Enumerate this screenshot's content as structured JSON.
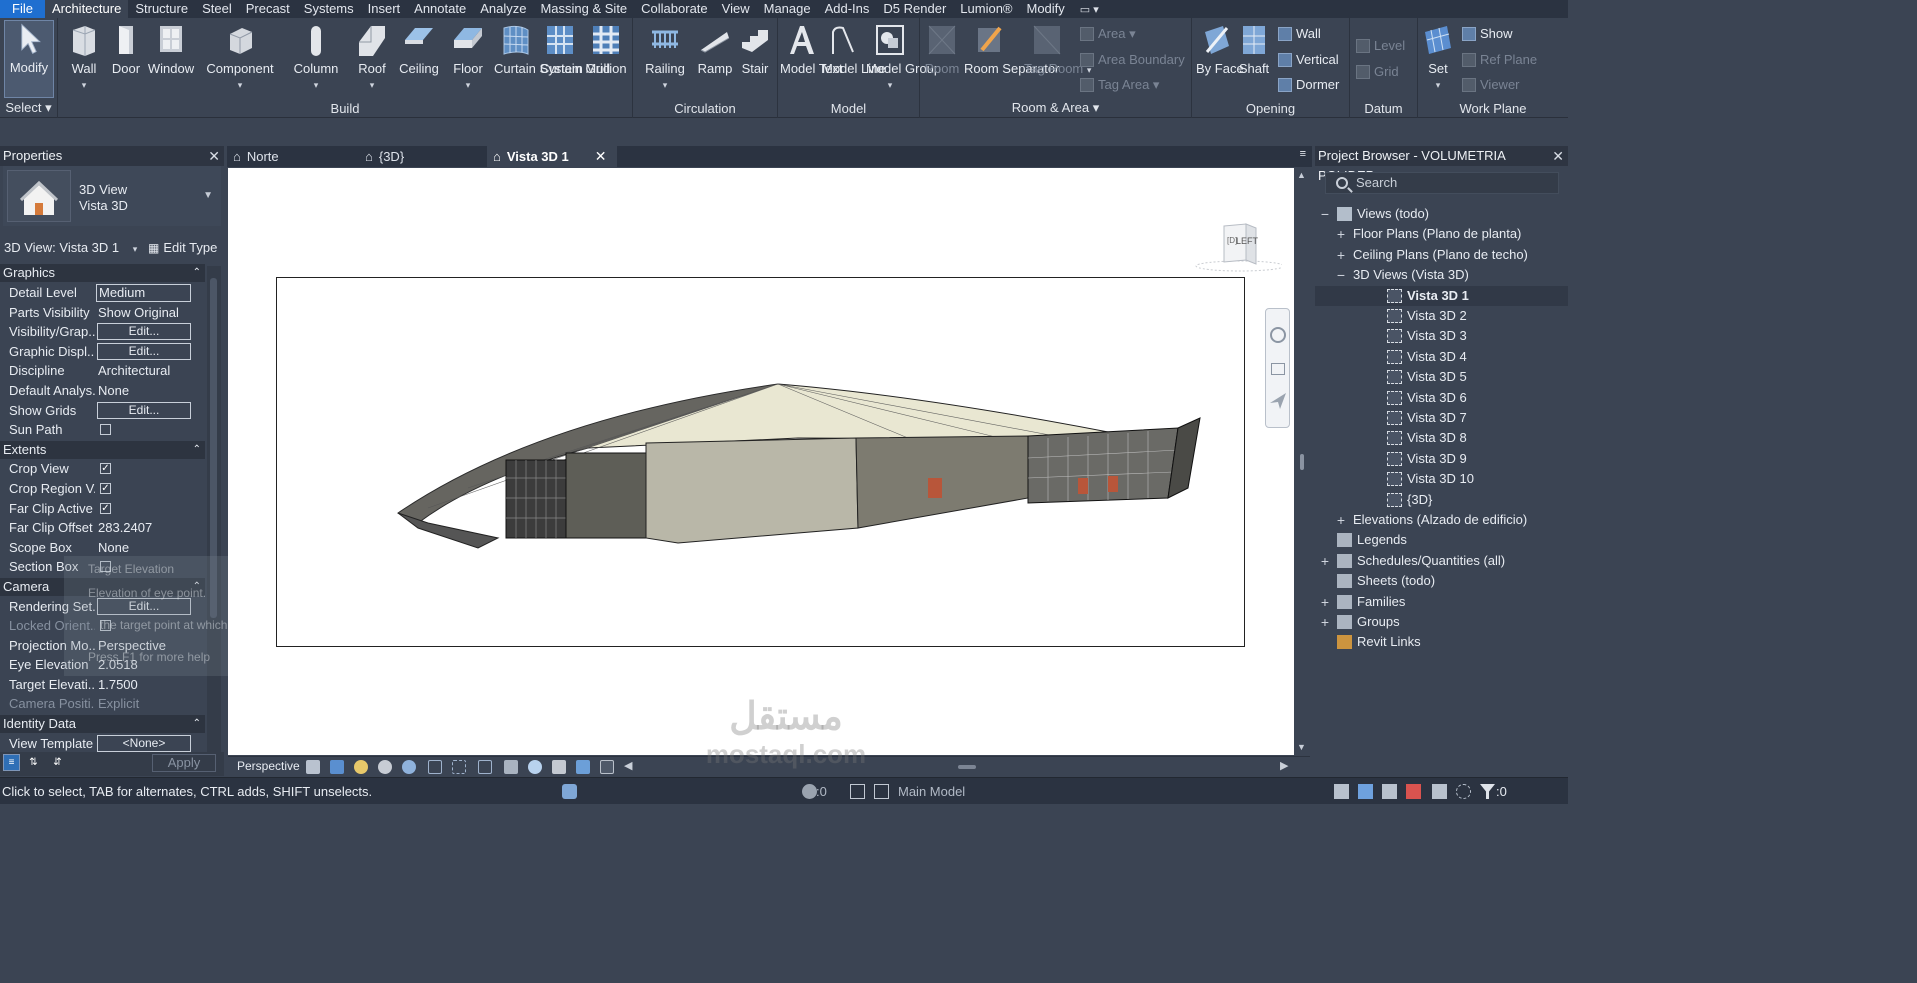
{
  "menu": {
    "items": [
      "File",
      "Architecture",
      "Structure",
      "Steel",
      "Precast",
      "Systems",
      "Insert",
      "Annotate",
      "Analyze",
      "Massing & Site",
      "Collaborate",
      "View",
      "Manage",
      "Add-Ins",
      "D5 Render",
      "Lumion®",
      "Modify"
    ],
    "active": "Architecture",
    "extra": "▭ ▾"
  },
  "ribbon": {
    "select": {
      "tool": "Modify",
      "title": "Select ▾"
    },
    "build": {
      "title": "Build",
      "tools": [
        "Wall",
        "Door",
        "Window",
        "Component",
        "Column",
        "Roof",
        "Ceiling",
        "Floor",
        "Curtain System",
        "Curtain Grid",
        "Mullion"
      ]
    },
    "circulation": {
      "title": "Circulation",
      "tools": [
        "Railing",
        "Ramp",
        "Stair"
      ]
    },
    "model": {
      "title": "Model",
      "tools": [
        "Model Text",
        "Model Line",
        "Model Group"
      ]
    },
    "room_area": {
      "title": "Room & Area ▾",
      "tools": [
        "Room",
        "Room Separator",
        "Tag Room"
      ],
      "small": [
        "Area ▾",
        "Area Boundary",
        "Tag Area ▾"
      ]
    },
    "opening": {
      "title": "Opening",
      "tools": [
        "By Face",
        "Shaft"
      ],
      "small": [
        "Wall",
        "Vertical",
        "Dormer"
      ]
    },
    "datum": {
      "title": "Datum",
      "small": [
        "Level",
        "Grid"
      ]
    },
    "work_plane": {
      "title": "Work Plane",
      "tools": [
        "Set"
      ],
      "small": [
        "Show",
        "Ref Plane",
        "Viewer"
      ]
    }
  },
  "properties": {
    "title": "Properties",
    "type_line1": "3D View",
    "type_line2": "Vista 3D",
    "view_selector": "3D View: Vista 3D 1",
    "edit_type": "Edit Type",
    "sections": {
      "graphics": "Graphics",
      "extents": "Extents",
      "camera": "Camera",
      "identity": "Identity Data"
    },
    "graphics_rows": [
      {
        "k": "Detail Level",
        "v": "Medium"
      },
      {
        "k": "Parts Visibility",
        "v": "Show Original"
      },
      {
        "k": "Visibility/Grap...",
        "v": "Edit..."
      },
      {
        "k": "Graphic Displ...",
        "v": "Edit..."
      },
      {
        "k": "Discipline",
        "v": "Architectural"
      },
      {
        "k": "Default Analys...",
        "v": "None"
      },
      {
        "k": "Show Grids",
        "v": "Edit..."
      },
      {
        "k": "Sun Path",
        "v": ""
      }
    ],
    "extents_rows": [
      {
        "k": "Crop View",
        "v": "✓"
      },
      {
        "k": "Crop Region V...",
        "v": "✓"
      },
      {
        "k": "Far Clip Active",
        "v": "✓"
      },
      {
        "k": "Far Clip Offset",
        "v": "283.2407"
      },
      {
        "k": "Scope Box",
        "v": "None"
      },
      {
        "k": "Section Box",
        "v": ""
      }
    ],
    "camera_rows": [
      {
        "k": "Rendering Set...",
        "v": "Edit..."
      },
      {
        "k": "Locked Orient...",
        "v": ""
      },
      {
        "k": "Projection Mo...",
        "v": "Perspective"
      },
      {
        "k": "Eye Elevation",
        "v": "2.0518"
      },
      {
        "k": "Target Elevati...",
        "v": "1.7500"
      },
      {
        "k": "Camera Positi...",
        "v": "Explicit"
      }
    ],
    "identity_rows": [
      {
        "k": "View Template",
        "v": "<None>"
      }
    ],
    "apply": "Apply"
  },
  "tooltip_ghost": {
    "title": "Target Elevation",
    "line1": "Elevation of eye point.",
    "line2": "the target point at which the camera is directed.",
    "line3": "Press F1 for more help"
  },
  "view_tabs": [
    {
      "label": "Norte",
      "icon": "house-icon"
    },
    {
      "label": "{3D}",
      "icon": "house-icon"
    },
    {
      "label": "Vista 3D 1",
      "icon": "house-icon",
      "active": true
    }
  ],
  "viewcube": {
    "face": "LEFT",
    "side": "[D]"
  },
  "view_control": {
    "projection": "Perspective"
  },
  "browser": {
    "title": "Project Browser - VOLUMETRIA POLIDEP...",
    "search_placeholder": "Search",
    "tree": [
      {
        "label": "Views (todo)",
        "level": 0,
        "toggle": "−",
        "icon": "views-icon"
      },
      {
        "label": "Floor Plans (Plano de planta)",
        "level": 1,
        "toggle": "+"
      },
      {
        "label": "Ceiling Plans (Plano de techo)",
        "level": 1,
        "toggle": "+"
      },
      {
        "label": "3D Views (Vista 3D)",
        "level": 1,
        "toggle": "−"
      },
      {
        "label": "Vista 3D 1",
        "level": 2,
        "icon": "view3d-icon",
        "selected": true
      },
      {
        "label": "Vista 3D 2",
        "level": 2,
        "icon": "view3d-icon"
      },
      {
        "label": "Vista 3D 3",
        "level": 2,
        "icon": "view3d-icon"
      },
      {
        "label": "Vista 3D 4",
        "level": 2,
        "icon": "view3d-icon"
      },
      {
        "label": "Vista 3D 5",
        "level": 2,
        "icon": "view3d-icon"
      },
      {
        "label": "Vista 3D 6",
        "level": 2,
        "icon": "view3d-icon"
      },
      {
        "label": "Vista 3D 7",
        "level": 2,
        "icon": "view3d-icon"
      },
      {
        "label": "Vista 3D 8",
        "level": 2,
        "icon": "view3d-icon"
      },
      {
        "label": "Vista 3D 9",
        "level": 2,
        "icon": "view3d-icon"
      },
      {
        "label": "Vista 3D 10",
        "level": 2,
        "icon": "view3d-icon"
      },
      {
        "label": "{3D}",
        "level": 2,
        "icon": "view3d-icon"
      },
      {
        "label": "Elevations (Alzado de edificio)",
        "level": 1,
        "toggle": "+"
      },
      {
        "label": "Legends",
        "level": 0,
        "icon": "legend-icon"
      },
      {
        "label": "Schedules/Quantities (all)",
        "level": 0,
        "toggle": "+",
        "icon": "schedule-icon"
      },
      {
        "label": "Sheets (todo)",
        "level": 0,
        "icon": "sheet-icon"
      },
      {
        "label": "Families",
        "level": 0,
        "toggle": "+",
        "icon": "family-icon"
      },
      {
        "label": "Groups",
        "level": 0,
        "toggle": "+",
        "icon": "group-icon"
      },
      {
        "label": "Revit Links",
        "level": 0,
        "icon": "link-icon"
      }
    ]
  },
  "status": {
    "message": "Click to select, TAB for alternates, CTRL adds, SHIFT unselects.",
    "workset_count": ":0",
    "model": "Main Model",
    "filter_count": ":0"
  },
  "watermark": {
    "line1": "مستقل",
    "line2": "mostaql.com"
  }
}
